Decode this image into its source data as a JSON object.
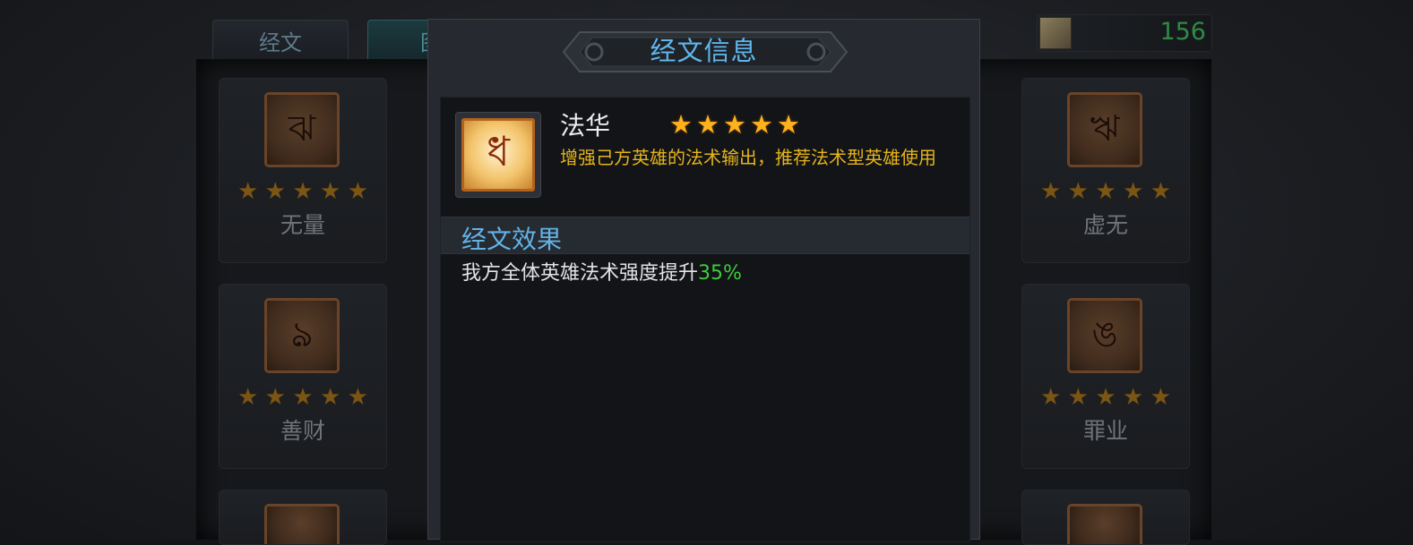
{
  "tabs": [
    {
      "label": "经文"
    },
    {
      "label": "图"
    }
  ],
  "currency": {
    "value": "156",
    "icon": "scroll-icon"
  },
  "left_cards": [
    {
      "name": "无量",
      "stars": 5
    },
    {
      "name": "善财",
      "stars": 5
    },
    {
      "name": "",
      "stars": 0
    }
  ],
  "right_cards": [
    {
      "name": "虚无",
      "stars": 5
    },
    {
      "name": "罪业",
      "stars": 5
    },
    {
      "name": "",
      "stars": 0
    }
  ],
  "modal": {
    "title": "经文信息",
    "item": {
      "name": "法华",
      "stars": 5,
      "description": "增强己方英雄的法术输出，推荐法术型英雄使用"
    },
    "effect_title": "经文效果",
    "effect_prefix": "我方全体英雄法术强度提升",
    "effect_value": "35%"
  },
  "colors": {
    "accent_blue": "#5fb6ec",
    "description_gold": "#e6b41a",
    "effect_green": "#3fcc3b",
    "star_gold": "#ffb21c",
    "currency_green": "#2f8a44"
  }
}
